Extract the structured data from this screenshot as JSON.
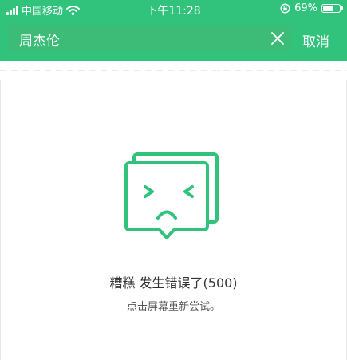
{
  "status_bar": {
    "carrier": "中国移动",
    "time": "下午11:28",
    "battery_percent_text": "69%",
    "battery_level": 0.69,
    "wifi_icon": "wifi-icon",
    "lock_icon": "orientation-lock-icon"
  },
  "search": {
    "query": "周杰伦",
    "clear_icon": "close-icon",
    "cancel_label": "取消"
  },
  "error": {
    "illustration_icon": "sad-face-message-icon",
    "title": "糟糕 发生错误了(500)",
    "subtitle": "点击屏幕重新尝试。"
  },
  "colors": {
    "accent": "#31c27c",
    "search_bg": "#3dbc78",
    "illustration": "#31c27c"
  }
}
